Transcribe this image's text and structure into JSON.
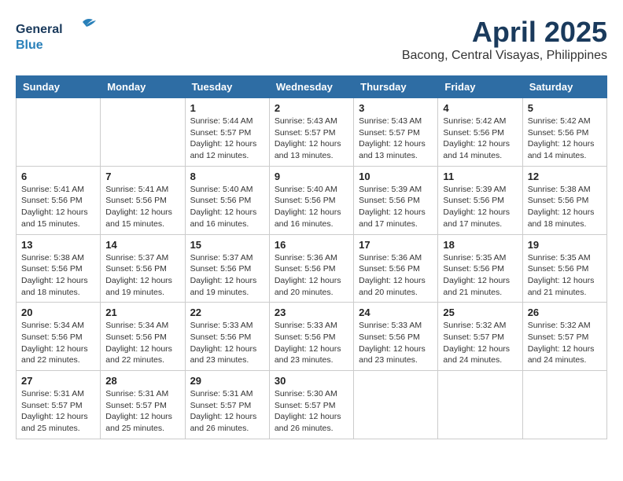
{
  "header": {
    "logo_general": "General",
    "logo_blue": "Blue",
    "month_title": "April 2025",
    "location": "Bacong, Central Visayas, Philippines"
  },
  "weekdays": [
    "Sunday",
    "Monday",
    "Tuesday",
    "Wednesday",
    "Thursday",
    "Friday",
    "Saturday"
  ],
  "weeks": [
    [
      {
        "day": "",
        "sunrise": "",
        "sunset": "",
        "daylight": ""
      },
      {
        "day": "",
        "sunrise": "",
        "sunset": "",
        "daylight": ""
      },
      {
        "day": "1",
        "sunrise": "Sunrise: 5:44 AM",
        "sunset": "Sunset: 5:57 PM",
        "daylight": "Daylight: 12 hours and 12 minutes."
      },
      {
        "day": "2",
        "sunrise": "Sunrise: 5:43 AM",
        "sunset": "Sunset: 5:57 PM",
        "daylight": "Daylight: 12 hours and 13 minutes."
      },
      {
        "day": "3",
        "sunrise": "Sunrise: 5:43 AM",
        "sunset": "Sunset: 5:57 PM",
        "daylight": "Daylight: 12 hours and 13 minutes."
      },
      {
        "day": "4",
        "sunrise": "Sunrise: 5:42 AM",
        "sunset": "Sunset: 5:56 PM",
        "daylight": "Daylight: 12 hours and 14 minutes."
      },
      {
        "day": "5",
        "sunrise": "Sunrise: 5:42 AM",
        "sunset": "Sunset: 5:56 PM",
        "daylight": "Daylight: 12 hours and 14 minutes."
      }
    ],
    [
      {
        "day": "6",
        "sunrise": "Sunrise: 5:41 AM",
        "sunset": "Sunset: 5:56 PM",
        "daylight": "Daylight: 12 hours and 15 minutes."
      },
      {
        "day": "7",
        "sunrise": "Sunrise: 5:41 AM",
        "sunset": "Sunset: 5:56 PM",
        "daylight": "Daylight: 12 hours and 15 minutes."
      },
      {
        "day": "8",
        "sunrise": "Sunrise: 5:40 AM",
        "sunset": "Sunset: 5:56 PM",
        "daylight": "Daylight: 12 hours and 16 minutes."
      },
      {
        "day": "9",
        "sunrise": "Sunrise: 5:40 AM",
        "sunset": "Sunset: 5:56 PM",
        "daylight": "Daylight: 12 hours and 16 minutes."
      },
      {
        "day": "10",
        "sunrise": "Sunrise: 5:39 AM",
        "sunset": "Sunset: 5:56 PM",
        "daylight": "Daylight: 12 hours and 17 minutes."
      },
      {
        "day": "11",
        "sunrise": "Sunrise: 5:39 AM",
        "sunset": "Sunset: 5:56 PM",
        "daylight": "Daylight: 12 hours and 17 minutes."
      },
      {
        "day": "12",
        "sunrise": "Sunrise: 5:38 AM",
        "sunset": "Sunset: 5:56 PM",
        "daylight": "Daylight: 12 hours and 18 minutes."
      }
    ],
    [
      {
        "day": "13",
        "sunrise": "Sunrise: 5:38 AM",
        "sunset": "Sunset: 5:56 PM",
        "daylight": "Daylight: 12 hours and 18 minutes."
      },
      {
        "day": "14",
        "sunrise": "Sunrise: 5:37 AM",
        "sunset": "Sunset: 5:56 PM",
        "daylight": "Daylight: 12 hours and 19 minutes."
      },
      {
        "day": "15",
        "sunrise": "Sunrise: 5:37 AM",
        "sunset": "Sunset: 5:56 PM",
        "daylight": "Daylight: 12 hours and 19 minutes."
      },
      {
        "day": "16",
        "sunrise": "Sunrise: 5:36 AM",
        "sunset": "Sunset: 5:56 PM",
        "daylight": "Daylight: 12 hours and 20 minutes."
      },
      {
        "day": "17",
        "sunrise": "Sunrise: 5:36 AM",
        "sunset": "Sunset: 5:56 PM",
        "daylight": "Daylight: 12 hours and 20 minutes."
      },
      {
        "day": "18",
        "sunrise": "Sunrise: 5:35 AM",
        "sunset": "Sunset: 5:56 PM",
        "daylight": "Daylight: 12 hours and 21 minutes."
      },
      {
        "day": "19",
        "sunrise": "Sunrise: 5:35 AM",
        "sunset": "Sunset: 5:56 PM",
        "daylight": "Daylight: 12 hours and 21 minutes."
      }
    ],
    [
      {
        "day": "20",
        "sunrise": "Sunrise: 5:34 AM",
        "sunset": "Sunset: 5:56 PM",
        "daylight": "Daylight: 12 hours and 22 minutes."
      },
      {
        "day": "21",
        "sunrise": "Sunrise: 5:34 AM",
        "sunset": "Sunset: 5:56 PM",
        "daylight": "Daylight: 12 hours and 22 minutes."
      },
      {
        "day": "22",
        "sunrise": "Sunrise: 5:33 AM",
        "sunset": "Sunset: 5:56 PM",
        "daylight": "Daylight: 12 hours and 23 minutes."
      },
      {
        "day": "23",
        "sunrise": "Sunrise: 5:33 AM",
        "sunset": "Sunset: 5:56 PM",
        "daylight": "Daylight: 12 hours and 23 minutes."
      },
      {
        "day": "24",
        "sunrise": "Sunrise: 5:33 AM",
        "sunset": "Sunset: 5:56 PM",
        "daylight": "Daylight: 12 hours and 23 minutes."
      },
      {
        "day": "25",
        "sunrise": "Sunrise: 5:32 AM",
        "sunset": "Sunset: 5:57 PM",
        "daylight": "Daylight: 12 hours and 24 minutes."
      },
      {
        "day": "26",
        "sunrise": "Sunrise: 5:32 AM",
        "sunset": "Sunset: 5:57 PM",
        "daylight": "Daylight: 12 hours and 24 minutes."
      }
    ],
    [
      {
        "day": "27",
        "sunrise": "Sunrise: 5:31 AM",
        "sunset": "Sunset: 5:57 PM",
        "daylight": "Daylight: 12 hours and 25 minutes."
      },
      {
        "day": "28",
        "sunrise": "Sunrise: 5:31 AM",
        "sunset": "Sunset: 5:57 PM",
        "daylight": "Daylight: 12 hours and 25 minutes."
      },
      {
        "day": "29",
        "sunrise": "Sunrise: 5:31 AM",
        "sunset": "Sunset: 5:57 PM",
        "daylight": "Daylight: 12 hours and 26 minutes."
      },
      {
        "day": "30",
        "sunrise": "Sunrise: 5:30 AM",
        "sunset": "Sunset: 5:57 PM",
        "daylight": "Daylight: 12 hours and 26 minutes."
      },
      {
        "day": "",
        "sunrise": "",
        "sunset": "",
        "daylight": ""
      },
      {
        "day": "",
        "sunrise": "",
        "sunset": "",
        "daylight": ""
      },
      {
        "day": "",
        "sunrise": "",
        "sunset": "",
        "daylight": ""
      }
    ]
  ]
}
